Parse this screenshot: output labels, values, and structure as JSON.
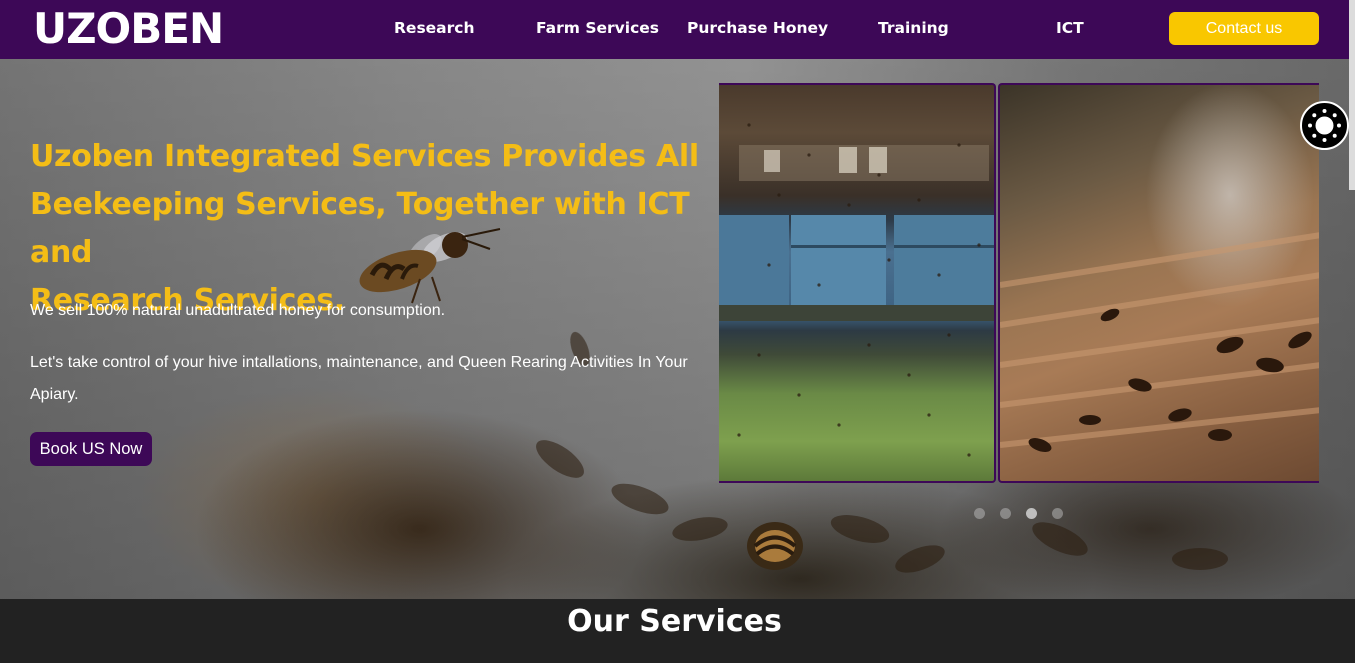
{
  "brand": {
    "logo_text": "UZOBEN"
  },
  "nav": {
    "items": [
      {
        "label": "Research"
      },
      {
        "label": "Farm Services"
      },
      {
        "label": "Purchase Honey"
      },
      {
        "label": "Training"
      },
      {
        "label": "ICT"
      }
    ],
    "contact_label": "Contact us"
  },
  "hero": {
    "headline_lines": [
      "Uzoben Integrated Services Provides All",
      "Beekeeping Services, Together with ICT and",
      "Research Services."
    ],
    "paragraph_1": "We sell 100% natural unadultrated honey for consumption.",
    "paragraph_2": "Let's take control of your hive intallations, maintenance, and Queen Rearing Activities In Your Apiary.",
    "cta_label": "Book US Now"
  },
  "carousel": {
    "dot_count": 4,
    "active_index": 2
  },
  "services": {
    "title": "Our Services"
  },
  "colors": {
    "brand_purple": "#3d0857",
    "accent_yellow": "#f9c700",
    "headline_yellow": "#f4bd16",
    "services_bg": "#222222"
  },
  "icons": [
    "accessibility-icon",
    "flying-bee-icon"
  ]
}
